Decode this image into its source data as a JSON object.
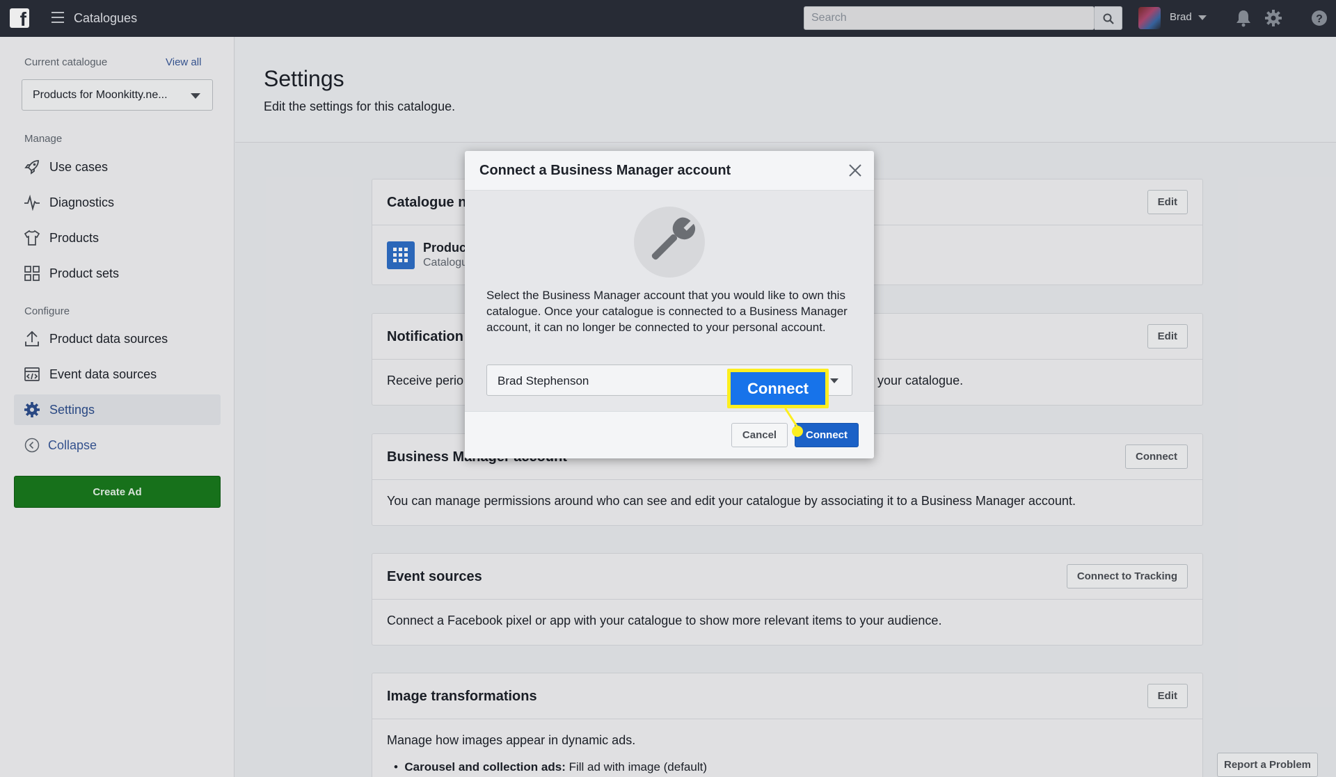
{
  "topbar": {
    "app_title": "Catalogues",
    "search_placeholder": "Search",
    "user_name": "Brad"
  },
  "sidebar": {
    "current_label": "Current catalogue",
    "view_all": "View all",
    "catalogue_selected": "Products for Moonkitty.ne...",
    "manage_label": "Manage",
    "configure_label": "Configure",
    "items": [
      {
        "label": "Use cases",
        "icon": "rocket-icon"
      },
      {
        "label": "Diagnostics",
        "icon": "pulse-icon"
      },
      {
        "label": "Products",
        "icon": "shirt-icon"
      },
      {
        "label": "Product sets",
        "icon": "grid-icon"
      },
      {
        "label": "Product data sources",
        "icon": "upload-icon"
      },
      {
        "label": "Event data sources",
        "icon": "event-icon"
      },
      {
        "label": "Settings",
        "icon": "gear-icon"
      },
      {
        "label": "Collapse",
        "icon": "chevron-left-icon"
      }
    ],
    "create_ad": "Create Ad"
  },
  "main": {
    "title": "Settings",
    "subtitle": "Edit the settings for this catalogue.",
    "cards": {
      "catalogue": {
        "title": "Catalogue n",
        "button": "Edit",
        "name": "Produc",
        "sub": "Catalogu"
      },
      "notifications": {
        "title": "Notification",
        "button": "Edit",
        "text_start": "Receive perio",
        "text_end": "your catalogue."
      },
      "business": {
        "title": "Business Manager account",
        "button": "Connect",
        "text": "You can manage permissions around who can see and edit your catalogue by associating it to a Business Manager account."
      },
      "events": {
        "title": "Event sources",
        "button": "Connect to Tracking",
        "text": "Connect a Facebook pixel or app with your catalogue to show more relevant items to your audience."
      },
      "images": {
        "title": "Image transformations",
        "button": "Edit",
        "text": "Manage how images appear in dynamic ads.",
        "bullet_bold": "Carousel and collection ads:",
        "bullet_rest": " Fill ad with image (default)"
      }
    },
    "report": "Report a Problem"
  },
  "modal": {
    "title": "Connect a Business Manager account",
    "text": "Select the Business Manager account that you would like to own this catalogue. Once your catalogue is connected to a Business Manager account, it can no longer be connected to your personal account.",
    "selected_account": "Brad Stephenson",
    "callout_label": "Connect",
    "cancel": "Cancel",
    "connect": "Connect"
  },
  "colors": {
    "topbar": "#2b2f3a",
    "create_ad": "#197a1e",
    "primary": "#1b61c7",
    "highlight": "#fcee21",
    "callout_blue": "#1773ea"
  }
}
